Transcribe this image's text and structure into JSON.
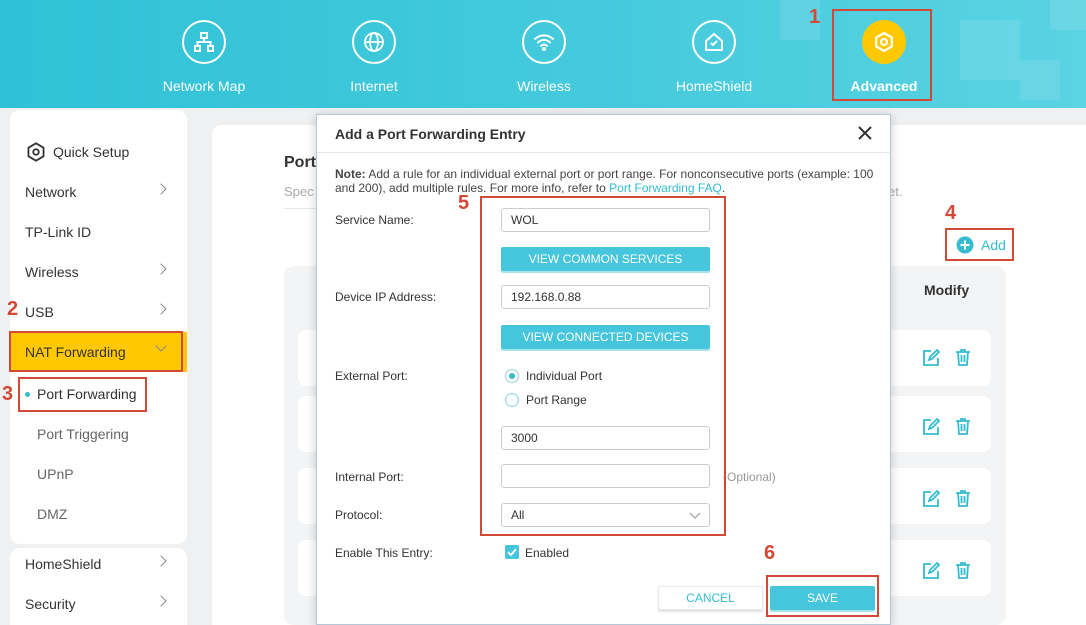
{
  "nav": {
    "items": [
      {
        "label": "Network Map",
        "icon": "network-map-icon"
      },
      {
        "label": "Internet",
        "icon": "globe-icon"
      },
      {
        "label": "Wireless",
        "icon": "wifi-icon"
      },
      {
        "label": "HomeShield",
        "icon": "home-shield-icon"
      },
      {
        "label": "Advanced",
        "icon": "gear-icon"
      }
    ]
  },
  "steps": [
    "1",
    "2",
    "3",
    "4",
    "5",
    "6"
  ],
  "sidebar": {
    "quick_setup": "Quick Setup",
    "items": [
      "Network",
      "TP-Link ID",
      "Wireless",
      "USB",
      "NAT Forwarding"
    ],
    "sub_items": [
      "Port Forwarding",
      "Port Triggering",
      "UPnP",
      "DMZ"
    ],
    "bottom_items": [
      "HomeShield",
      "Security"
    ]
  },
  "page": {
    "title_partial": "Port",
    "desc_left": "Spec",
    "desc_right": "et.",
    "add_label": "Add",
    "modify_header": "Modify"
  },
  "modal": {
    "title": "Add a Port Forwarding Entry",
    "note_bold": "Note:",
    "note_text": "Add a rule for an individual external port or port range. For nonconsecutive ports (example: 100 and 200), add multiple rules. For more info, refer to",
    "note_link": "Port Forwarding FAQ",
    "note_end": ".",
    "service_name_label": "Service Name:",
    "service_name_value": "WOL",
    "view_common_services": "VIEW COMMON SERVICES",
    "device_ip_label": "Device IP Address:",
    "device_ip_value": "192.168.0.88",
    "view_connected_devices": "VIEW CONNECTED DEVICES",
    "external_port_label": "External Port:",
    "individual_port": "Individual Port",
    "port_range": "Port Range",
    "external_port_value": "3000",
    "internal_port_label": "Internal Port:",
    "internal_port_value": "",
    "optional": "(Optional)",
    "protocol_label": "Protocol:",
    "protocol_value": "All",
    "enable_label": "Enable This Entry:",
    "enabled_label": "Enabled",
    "cancel": "CANCEL",
    "save": "SAVE"
  },
  "colors": {
    "accent": "#35bcd1",
    "highlight": "#ffc800",
    "callout": "#d24a35"
  }
}
